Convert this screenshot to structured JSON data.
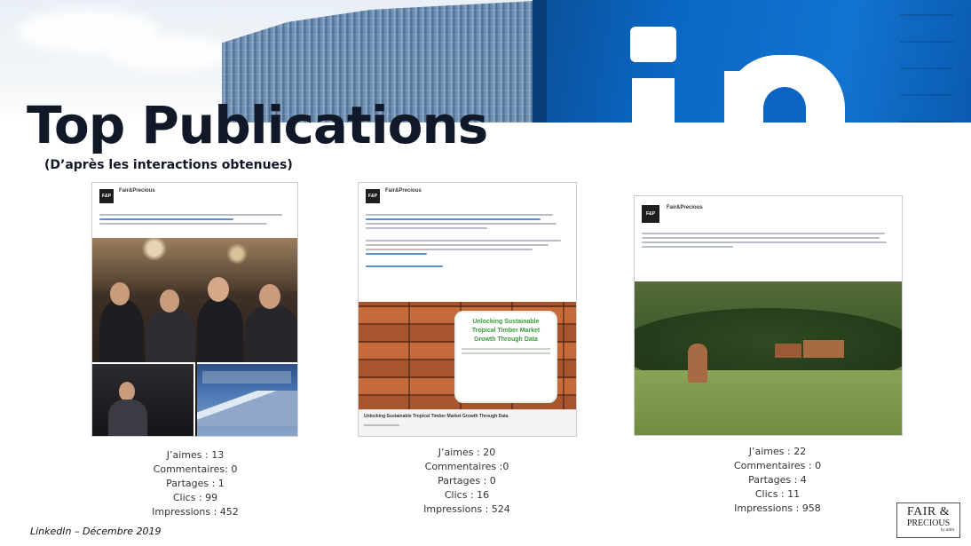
{
  "title": "Top Publications",
  "subtitle": "(D’après les interactions obtenues)",
  "footer": "LinkedIn – Décembre 2019",
  "logo": {
    "line1": "FAIR &",
    "line2": "PRECIOUS",
    "line3": "by atibt"
  },
  "colors": {
    "linkedin_blue": "#0a66c2",
    "title": "#111827"
  },
  "posts": [
    {
      "author": "Fair&Precious",
      "badge_text": "",
      "stats": [
        "J’aimes : 13",
        "Commentaires: 0",
        "Partages : 1",
        "Clics : 99",
        "Impressions : 452"
      ]
    },
    {
      "author": "Fair&Precious",
      "badge_text": "Unlocking Sustainable Tropical Timber Market Growth Through Data",
      "footer_text": "Unlocking Sustainable Tropical Timber Market Growth Through Data",
      "stats": [
        "J’aimes : 20",
        "Commentaires :0",
        "Partages : 0",
        "Clics : 16",
        "Impressions : 524"
      ]
    },
    {
      "author": "Fair&Precious",
      "stats": [
        "J’aimes : 22",
        "Commentaires : 0",
        "Partages : 4",
        "Clics : 11",
        "Impressions : 958"
      ]
    }
  ]
}
